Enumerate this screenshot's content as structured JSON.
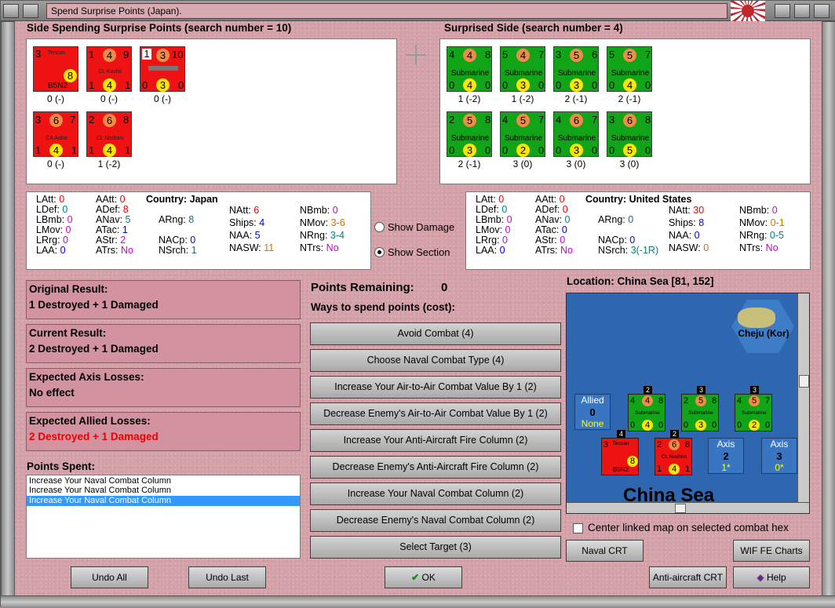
{
  "window": {
    "title": "Spend Surprise Points (Japan)."
  },
  "attacker": {
    "header": "Side Spending Surprise Points (search number = 10)",
    "units": [
      {
        "tl": "3",
        "tm": "",
        "tr": "",
        "name": "Tenzan",
        "bl": "",
        "bm": "8",
        "br": "",
        "extra": "B5N2",
        "label": "0 (-)"
      },
      {
        "tl": "1",
        "tm": "4",
        "tr": "9",
        "name": "CL Kashii",
        "bl": "1",
        "bm": "4",
        "br": "1",
        "extra": "",
        "label": "0 (-)"
      },
      {
        "tl": "1",
        "tm": "3",
        "tr": "10",
        "name": "",
        "bl": "0",
        "bm": "3",
        "br": "0",
        "extra": "",
        "label": "0 (-)"
      },
      {
        "tl": "3",
        "tm": "6",
        "tr": "7",
        "name": "CA Aoba",
        "bl": "1",
        "bm": "4",
        "br": "1",
        "extra": "",
        "label": "0 (-)"
      },
      {
        "tl": "2",
        "tm": "6",
        "tr": "8",
        "name": "CL Noshiro",
        "bl": "1",
        "bm": "4",
        "br": "1",
        "extra": "",
        "label": "1 (-2)"
      }
    ]
  },
  "defender": {
    "header": "Surprised Side (search number = 4)",
    "units": [
      {
        "tl": "4",
        "tm": "4",
        "tr": "8",
        "name": "Submarine",
        "bl": "0",
        "bm": "4",
        "br": "0",
        "label": "1 (-2)"
      },
      {
        "tl": "5",
        "tm": "4",
        "tr": "7",
        "name": "Submarine",
        "bl": "0",
        "bm": "3",
        "br": "0",
        "label": "1 (-2)"
      },
      {
        "tl": "3",
        "tm": "5",
        "tr": "6",
        "name": "Submarine",
        "bl": "0",
        "bm": "3",
        "br": "0",
        "label": "2 (-1)"
      },
      {
        "tl": "5",
        "tm": "5",
        "tr": "7",
        "name": "Submarine",
        "bl": "0",
        "bm": "4",
        "br": "0",
        "label": "2 (-1)"
      },
      {
        "tl": "2",
        "tm": "5",
        "tr": "8",
        "name": "Submarine",
        "bl": "0",
        "bm": "3",
        "br": "0",
        "label": "2 (-1)"
      },
      {
        "tl": "4",
        "tm": "5",
        "tr": "7",
        "name": "Submarine",
        "bl": "0",
        "bm": "2",
        "br": "0",
        "label": "3 (0)"
      },
      {
        "tl": "4",
        "tm": "6",
        "tr": "7",
        "name": "Submarine",
        "bl": "0",
        "bm": "3",
        "br": "0",
        "label": "3 (0)"
      },
      {
        "tl": "3",
        "tm": "6",
        "tr": "8",
        "name": "Submarine",
        "bl": "0",
        "bm": "5",
        "br": "0",
        "label": "3 (0)"
      }
    ]
  },
  "stats_left": {
    "country_label": "Country:",
    "country": "Japan",
    "LAtt": "0",
    "LDef": "0",
    "LBmb": "0",
    "LMov": "0",
    "LRrg": "0",
    "LAA": "0",
    "AAtt": "0",
    "ADef": "8",
    "ANav": "5",
    "ATac": "1",
    "AStr": "2",
    "ATrs": "No",
    "ARng": "8",
    "NACp": "0",
    "NSrch": "1",
    "NAtt": "6",
    "Ships": "4",
    "NAA": "5",
    "NASW": "11",
    "NBmb": "0",
    "NMov": "3-6",
    "NRng": "3-4",
    "NTrs": "No"
  },
  "stats_right": {
    "country_label": "Country:",
    "country": "United States",
    "LAtt": "0",
    "LDef": "0",
    "LBmb": "0",
    "LMov": "0",
    "LRrg": "0",
    "LAA": "0",
    "AAtt": "0",
    "ADef": "0",
    "ANav": "0",
    "ATac": "0",
    "AStr": "0",
    "ATrs": "No",
    "ARng": "0",
    "NACp": "0",
    "NSrch": "3(-1R)",
    "NAtt": "30",
    "Ships": "8",
    "NAA": "0",
    "NASW": "0",
    "NBmb": "0",
    "NMov": "0-1",
    "NRng": "0-5",
    "NTrs": "No"
  },
  "options": {
    "show_damage": "Show Damage",
    "show_section": "Show Section"
  },
  "results": {
    "original_label": "Original Result:",
    "original": "1 Destroyed + 1 Damaged",
    "current_label": "Current Result:",
    "current": "2 Destroyed + 1 Damaged",
    "axis_label": "Expected Axis Losses:",
    "axis": "No effect",
    "allied_label": "Expected Allied Losses:",
    "allied": "2 Destroyed + 1 Damaged"
  },
  "points_spent": {
    "label": "Points Spent:",
    "items": [
      "Increase Your Naval Combat Column",
      "Increase Your Naval Combat Column",
      "Increase Your Naval Combat Column"
    ]
  },
  "spend": {
    "remaining_label": "Points Remaining:",
    "remaining": "0",
    "ways_label": "Ways to spend points (cost):",
    "options": [
      "Avoid Combat (4)",
      "Choose Naval Combat Type (4)",
      "Increase Your Air-to-Air Combat Value By 1 (2)",
      "Decrease Enemy's Air-to-Air Combat Value By 1 (2)",
      "Increase Your Anti-Aircraft Fire Column (2)",
      "Decrease Enemy's Anti-Aircraft Fire Column (2)",
      "Increase Your Naval Combat Column (2)",
      "Decrease Enemy's Naval Combat Column (2)",
      "Select Target (3)"
    ]
  },
  "map": {
    "location": "Location: China Sea [81, 152]",
    "sea_name": "China Sea",
    "land_name": "Cheju (Kor)",
    "allied_box": {
      "title": "Allied",
      "value": "0",
      "sub": "None"
    },
    "axis_box1": {
      "title": "Axis",
      "value": "2",
      "sub": "1*"
    },
    "axis_box2": {
      "title": "Axis",
      "value": "3",
      "sub": "0*"
    },
    "stack_counts": [
      "2",
      "3",
      "3",
      "4",
      "2"
    ],
    "center_linked": "Center linked map on selected combat hex"
  },
  "buttons": {
    "undo_all": "Undo All",
    "undo_last": "Undo Last",
    "ok": "OK",
    "naval_crt": "Naval CRT",
    "wif_charts": "WIF FE Charts",
    "aa_crt": "Anti-aircraft CRT",
    "help": "Help"
  },
  "colors": {
    "red_unit": "#ee1212",
    "green_unit": "#12a418",
    "map_sea": "#2e66b0"
  }
}
